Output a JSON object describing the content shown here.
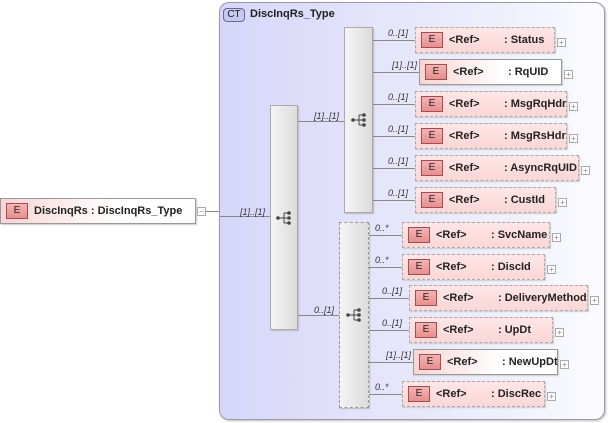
{
  "root": {
    "badge": "E",
    "label": "DiscInqRs : DiscInqRs_Type",
    "collapse": "−"
  },
  "complex_type": {
    "badge": "CT",
    "name": "DiscInqRs_Type"
  },
  "cardinalities": {
    "root_to_seq": "[1]..[1]",
    "seq_top": "[1]..[1]",
    "seq_bottom": "0..[1]"
  },
  "top_children": [
    {
      "badge": "E",
      "ref": "<Ref>",
      "name": ": Status",
      "card": "0..[1]",
      "expand": "+"
    },
    {
      "badge": "E",
      "ref": "<Ref>",
      "name": ": RqUID",
      "card": "[1]..[1]",
      "expand": "+"
    },
    {
      "badge": "E",
      "ref": "<Ref>",
      "name": ": MsgRqHdr",
      "card": "0..[1]",
      "expand": "+"
    },
    {
      "badge": "E",
      "ref": "<Ref>",
      "name": ": MsgRsHdr",
      "card": "0..[1]",
      "expand": "+"
    },
    {
      "badge": "E",
      "ref": "<Ref>",
      "name": ": AsyncRqUID",
      "card": "0..[1]",
      "expand": "+"
    },
    {
      "badge": "E",
      "ref": "<Ref>",
      "name": ": CustId",
      "card": "0..[1]",
      "expand": "+"
    }
  ],
  "bottom_children": [
    {
      "badge": "E",
      "ref": "<Ref>",
      "name": ": SvcName",
      "card": "0..*",
      "expand": "+"
    },
    {
      "badge": "E",
      "ref": "<Ref>",
      "name": ": DiscId",
      "card": "0..*",
      "expand": "+"
    },
    {
      "badge": "E",
      "ref": "<Ref>",
      "name": ": DeliveryMethod",
      "card": "0..[1]",
      "expand": "+"
    },
    {
      "badge": "E",
      "ref": "<Ref>",
      "name": ": UpDt",
      "card": "0..[1]",
      "expand": "+"
    },
    {
      "badge": "E",
      "ref": "<Ref>",
      "name": ": NewUpDt",
      "card": "[1]..[1]",
      "expand": "+"
    },
    {
      "badge": "E",
      "ref": "<Ref>",
      "name": ": DiscRec",
      "card": "0..*",
      "expand": "+"
    }
  ]
}
